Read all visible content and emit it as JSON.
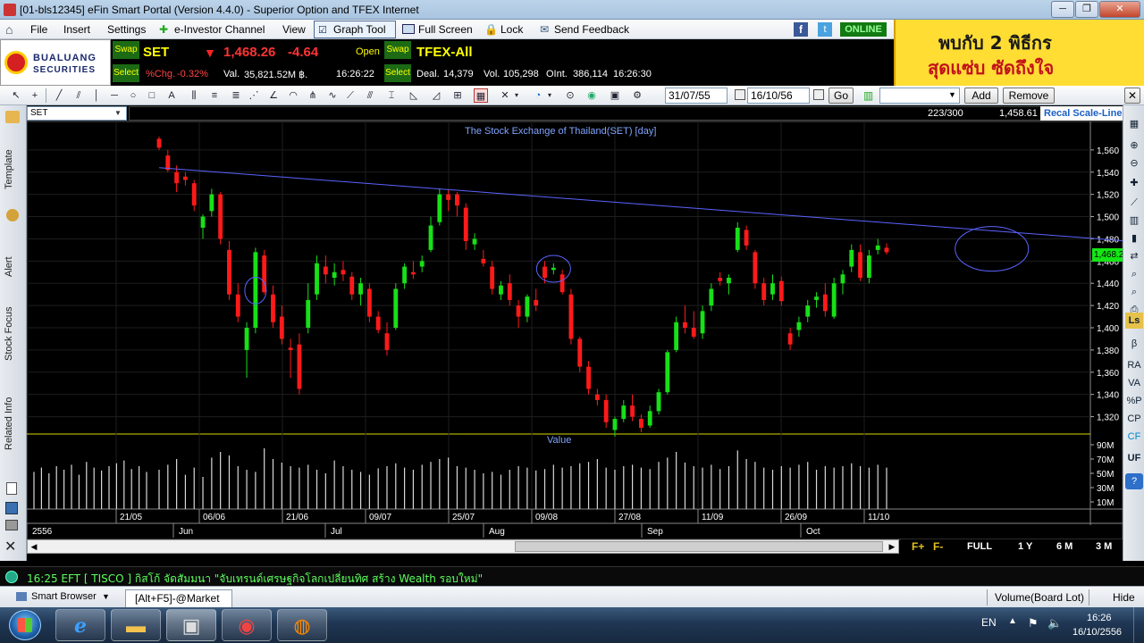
{
  "window": {
    "title": "[01-bls12345] eFin Smart Portal (Version 4.4.0) - Superior Option and TFEX Internet"
  },
  "menu": {
    "file": "File",
    "insert": "Insert",
    "settings": "Settings",
    "investor": "e-Investor Channel",
    "view": "View",
    "graph_tool": "Graph Tool",
    "full_screen": "Full Screen",
    "lock": "Lock",
    "send_feedback": "Send Feedback",
    "online": "ONLINE"
  },
  "brand": {
    "logo_top": "BUALUANG",
    "logo_bottom": "SECURITIES"
  },
  "quote_set": {
    "swap": "Swap",
    "select": "Select",
    "symbol": "SET",
    "arrow": "▼",
    "price": "1,468.26",
    "change": "-4.64",
    "open_label": "Open",
    "pct_label": "%Chg.",
    "pct": "-0.32%",
    "val_label": "Val.",
    "val": "35,821.52M ฿.",
    "time": "16:26:22"
  },
  "quote_tfex": {
    "swap": "Swap",
    "select": "Select",
    "symbol": "TFEX-All",
    "deal_label": "Deal.",
    "deal": "14,379",
    "vol_label": "Vol.",
    "vol": "105,298",
    "oint_label": "OInt.",
    "oint": "386,114",
    "time": "16:26:30"
  },
  "ad": {
    "line1": "พบกับ 2 พิธีกร",
    "line2": "สุดแซ่บ ซัดถึงใจ"
  },
  "toolbar": {
    "date_from": "31/07/55",
    "date_to": "16/10/56",
    "go": "Go",
    "add": "Add",
    "remove": "Remove"
  },
  "chart_header": {
    "symbol": "SET",
    "count": "223/300",
    "last": "1,458.61",
    "scale_mode": "Recal Scale-Line"
  },
  "left_tabs": [
    "Template",
    "Alert",
    "Stock Focus",
    "Related Info"
  ],
  "right_tools": [
    "RA",
    "VA",
    "%P",
    "CP",
    "CF",
    "UF"
  ],
  "chart_data": {
    "type": "candlestick",
    "title": "The Stock Exchange of Thailand(SET) [day]",
    "volume_title": "Value",
    "current_price_label": "1,468.2",
    "y_ticks": [
      1560,
      1540,
      1520,
      1500,
      1480,
      1460,
      1440,
      1420,
      1400,
      1380,
      1360,
      1340,
      1320
    ],
    "y_tick_labels": [
      "1,560",
      "1,540",
      "1,520",
      "1,500",
      "1,480",
      "1,460",
      "1,440",
      "1,420",
      "1,400",
      "1,380",
      "1,360",
      "1,340",
      "1,320"
    ],
    "ylim": [
      1306,
      1584
    ],
    "volume_ticks": [
      "90M",
      "70M",
      "50M",
      "30M",
      "10M"
    ],
    "volume_ylim": [
      0,
      100
    ],
    "x_date_labels": [
      "21/05",
      "06/06",
      "21/06",
      "09/07",
      "25/07",
      "09/08",
      "27/08",
      "11/09",
      "26/09",
      "11/10"
    ],
    "x_month_labels": [
      "2556",
      "Jun",
      "Jul",
      "Aug",
      "Sep",
      "Oct"
    ],
    "trendline": {
      "start": [
        0,
        1544
      ],
      "end": [
        129,
        1467
      ]
    },
    "highlight_ellipses_at_index": [
      11,
      45,
      95,
      120
    ],
    "candles": [
      [
        1570,
        1572,
        1560,
        1562
      ],
      [
        1555,
        1560,
        1540,
        1542
      ],
      [
        1540,
        1546,
        1522,
        1530
      ],
      [
        1536,
        1540,
        1528,
        1533
      ],
      [
        1530,
        1533,
        1505,
        1510
      ],
      [
        1490,
        1502,
        1480,
        1500
      ],
      [
        1505,
        1525,
        1500,
        1520
      ],
      [
        1520,
        1522,
        1475,
        1480
      ],
      [
        1470,
        1478,
        1425,
        1430
      ],
      [
        1430,
        1440,
        1405,
        1410
      ],
      [
        1380,
        1405,
        1355,
        1400
      ],
      [
        1400,
        1472,
        1395,
        1468
      ],
      [
        1465,
        1470,
        1430,
        1432
      ],
      [
        1430,
        1438,
        1400,
        1405
      ],
      [
        1410,
        1420,
        1385,
        1390
      ],
      [
        1382,
        1390,
        1355,
        1380
      ],
      [
        1385,
        1395,
        1340,
        1345
      ],
      [
        1400,
        1440,
        1395,
        1425
      ],
      [
        1430,
        1465,
        1425,
        1458
      ],
      [
        1455,
        1465,
        1440,
        1448
      ],
      [
        1445,
        1458,
        1438,
        1450
      ],
      [
        1452,
        1460,
        1442,
        1448
      ],
      [
        1446,
        1450,
        1425,
        1430
      ],
      [
        1430,
        1445,
        1420,
        1440
      ],
      [
        1435,
        1440,
        1405,
        1410
      ],
      [
        1410,
        1415,
        1395,
        1398
      ],
      [
        1395,
        1405,
        1375,
        1380
      ],
      [
        1400,
        1440,
        1398,
        1435
      ],
      [
        1440,
        1458,
        1435,
        1455
      ],
      [
        1450,
        1460,
        1444,
        1448
      ],
      [
        1455,
        1465,
        1450,
        1460
      ],
      [
        1470,
        1500,
        1468,
        1492
      ],
      [
        1495,
        1525,
        1492,
        1520
      ],
      [
        1520,
        1524,
        1505,
        1515
      ],
      [
        1520,
        1522,
        1500,
        1510
      ],
      [
        1508,
        1512,
        1470,
        1478
      ],
      [
        1475,
        1485,
        1470,
        1480
      ],
      [
        1462,
        1470,
        1455,
        1458
      ],
      [
        1455,
        1460,
        1430,
        1435
      ],
      [
        1430,
        1442,
        1425,
        1438
      ],
      [
        1440,
        1448,
        1420,
        1425
      ],
      [
        1420,
        1425,
        1400,
        1410
      ],
      [
        1410,
        1430,
        1405,
        1428
      ],
      [
        1425,
        1435,
        1415,
        1420
      ],
      [
        1455,
        1460,
        1440,
        1445
      ],
      [
        1452,
        1458,
        1448,
        1454
      ],
      [
        1448,
        1452,
        1430,
        1432
      ],
      [
        1430,
        1435,
        1385,
        1390
      ],
      [
        1390,
        1392,
        1360,
        1365
      ],
      [
        1365,
        1370,
        1340,
        1345
      ],
      [
        1340,
        1345,
        1330,
        1335
      ],
      [
        1335,
        1340,
        1310,
        1315
      ],
      [
        1308,
        1320,
        1302,
        1318
      ],
      [
        1318,
        1335,
        1315,
        1330
      ],
      [
        1330,
        1340,
        1316,
        1320
      ],
      [
        1318,
        1322,
        1306,
        1310
      ],
      [
        1312,
        1330,
        1310,
        1325
      ],
      [
        1325,
        1345,
        1322,
        1342
      ],
      [
        1342,
        1380,
        1340,
        1378
      ],
      [
        1380,
        1410,
        1378,
        1405
      ],
      [
        1405,
        1420,
        1395,
        1400
      ],
      [
        1400,
        1415,
        1390,
        1392
      ],
      [
        1395,
        1420,
        1390,
        1415
      ],
      [
        1420,
        1440,
        1415,
        1435
      ],
      [
        1445,
        1450,
        1438,
        1442
      ],
      [
        1440,
        1448,
        1430,
        1445
      ],
      [
        1470,
        1495,
        1468,
        1490
      ],
      [
        1488,
        1492,
        1470,
        1474
      ],
      [
        1468,
        1470,
        1435,
        1440
      ],
      [
        1440,
        1445,
        1420,
        1425
      ],
      [
        1430,
        1448,
        1425,
        1440
      ],
      [
        1442,
        1446,
        1420,
        1424
      ],
      [
        1395,
        1400,
        1380,
        1385
      ],
      [
        1398,
        1410,
        1392,
        1405
      ],
      [
        1410,
        1425,
        1405,
        1420
      ],
      [
        1425,
        1432,
        1418,
        1428
      ],
      [
        1430,
        1440,
        1410,
        1415
      ],
      [
        1410,
        1445,
        1408,
        1440
      ],
      [
        1440,
        1452,
        1430,
        1448
      ],
      [
        1455,
        1475,
        1450,
        1470
      ],
      [
        1468,
        1475,
        1442,
        1445
      ],
      [
        1445,
        1470,
        1440,
        1465
      ],
      [
        1470,
        1480,
        1466,
        1474
      ],
      [
        1472,
        1476,
        1466,
        1468
      ]
    ],
    "volume": [
      55,
      62,
      70,
      48,
      58,
      45,
      72,
      80,
      75,
      60,
      55,
      52,
      85,
      70,
      65,
      60,
      58,
      62,
      55,
      50,
      68,
      60,
      55,
      52,
      48,
      57,
      60,
      64,
      58,
      55,
      62,
      66,
      70,
      72,
      60,
      58,
      55,
      50,
      52,
      48,
      55,
      60,
      58,
      54,
      56,
      62,
      58,
      60,
      64,
      66,
      70,
      58,
      55,
      60,
      62,
      58,
      56,
      66,
      72,
      80,
      65,
      60,
      58,
      62,
      56,
      60,
      82,
      70,
      66,
      58,
      55,
      60,
      58,
      62,
      66,
      55,
      60,
      58,
      60,
      64,
      60,
      58,
      62,
      58
    ]
  },
  "ticker": {
    "text": "16:25  EFT  [ TISCO ]  กิสโก้ จัดสัมมนา \"จับเทรนด์เศรษฐกิจโลกเปลี่ยนทิศ สร้าง Wealth รอบใหม่\""
  },
  "bottom": {
    "smart_browser": "Smart Browser",
    "tab": "[Alt+F5]-@Market",
    "volume_mode": "Volume(Board Lot)",
    "hide": "Hide"
  },
  "range_buttons": [
    "FULL",
    "1 Y",
    "6 M",
    "3 M"
  ],
  "taskbar": {
    "lang": "EN",
    "time": "16:26",
    "date": "16/10/2556"
  }
}
